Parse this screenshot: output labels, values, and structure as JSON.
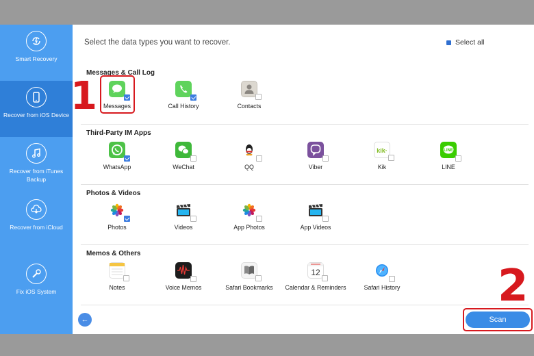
{
  "header": {
    "prompt": "Select the data types you want to recover.",
    "select_all": "Select all"
  },
  "sidebar": {
    "items": [
      {
        "label": "Smart Recovery",
        "icon": "lightning-refresh-icon",
        "active": false
      },
      {
        "label": "Recover from iOS Device",
        "icon": "phone-icon",
        "active": true
      },
      {
        "label": "Recover from iTunes Backup",
        "icon": "music-note-icon",
        "active": false
      },
      {
        "label": "Recover from iCloud",
        "icon": "cloud-download-icon",
        "active": false
      },
      {
        "label": "Fix iOS System",
        "icon": "wrench-icon",
        "active": false
      }
    ]
  },
  "sections": [
    {
      "title": "Messages & Call Log",
      "items": [
        {
          "label": "Messages",
          "icon": "messages-icon",
          "checked": true
        },
        {
          "label": "Call History",
          "icon": "phone-call-icon",
          "checked": true
        },
        {
          "label": "Contacts",
          "icon": "contacts-icon",
          "checked": false
        }
      ]
    },
    {
      "title": "Third-Party IM Apps",
      "items": [
        {
          "label": "WhatsApp",
          "icon": "whatsapp-icon",
          "checked": true
        },
        {
          "label": "WeChat",
          "icon": "wechat-icon",
          "checked": false
        },
        {
          "label": "QQ",
          "icon": "qq-icon",
          "checked": false
        },
        {
          "label": "Viber",
          "icon": "viber-icon",
          "checked": false
        },
        {
          "label": "Kik",
          "icon": "kik-icon",
          "checked": false
        },
        {
          "label": "LINE",
          "icon": "line-icon",
          "checked": false
        }
      ]
    },
    {
      "title": "Photos & Videos",
      "items": [
        {
          "label": "Photos",
          "icon": "photos-icon",
          "checked": true
        },
        {
          "label": "Videos",
          "icon": "videos-icon",
          "checked": false
        },
        {
          "label": "App Photos",
          "icon": "app-photos-icon",
          "checked": false
        },
        {
          "label": "App Videos",
          "icon": "app-videos-icon",
          "checked": false
        }
      ]
    },
    {
      "title": "Memos & Others",
      "items": [
        {
          "label": "Notes",
          "icon": "notes-icon",
          "checked": false
        },
        {
          "label": "Voice Memos",
          "icon": "voice-memos-icon",
          "checked": false
        },
        {
          "label": "Safari Bookmarks",
          "icon": "bookmarks-icon",
          "checked": false
        },
        {
          "label": "Calendar & Reminders",
          "icon": "calendar-icon",
          "checked": false,
          "icon_text": "12"
        },
        {
          "label": "Safari History",
          "icon": "safari-icon",
          "checked": false
        }
      ]
    }
  ],
  "footer": {
    "scan_label": "Scan",
    "back_icon": "back-arrow-icon"
  },
  "annotations": {
    "one": "1",
    "two": "2"
  },
  "colors": {
    "sidebar": "#4c9ef0",
    "sidebar_active": "#2f7fd8",
    "accent": "#3a8ce6",
    "annotation": "#d7191e"
  }
}
